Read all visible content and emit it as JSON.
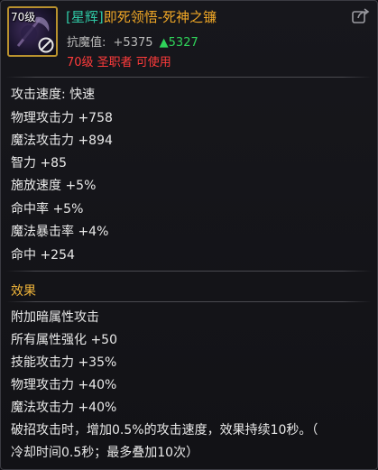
{
  "item": {
    "level_badge": "70级",
    "title_prefix": "[星辉]",
    "title_name": "即死领悟-死神之镰",
    "resist_label": "抗魔值:",
    "resist_value": "+5375",
    "resist_delta": "▲5327",
    "requirement": "70级 圣职者 可使用"
  },
  "stats": [
    "攻击速度: 快速",
    "物理攻击力 +758",
    "魔法攻击力 +894",
    "智力 +85",
    "施放速度 +5%",
    "命中率 +5%",
    "魔法暴击率 +4%",
    "命中 +254"
  ],
  "effects": {
    "title": "效果",
    "lines": [
      "附加暗属性攻击",
      "所有属性强化 +50",
      "技能攻击力 +35%",
      "物理攻击力 +40%",
      "魔法攻击力 +40%",
      "破招攻击时，增加0.5%的攻击速度，效果持续10秒。（",
      "冷却时间0.5秒；最多叠加10次）"
    ]
  },
  "colors": {
    "title_prefix": "#2ec7a4",
    "title_name": "#f0a726",
    "requirement": "#ff3b3b",
    "resist_delta": "#2fd35a",
    "effect_title": "#f0b53a",
    "icon_border": "#b8912e"
  },
  "icons": [
    "weapon-scythe-icon",
    "locked-icon",
    "share-icon"
  ]
}
